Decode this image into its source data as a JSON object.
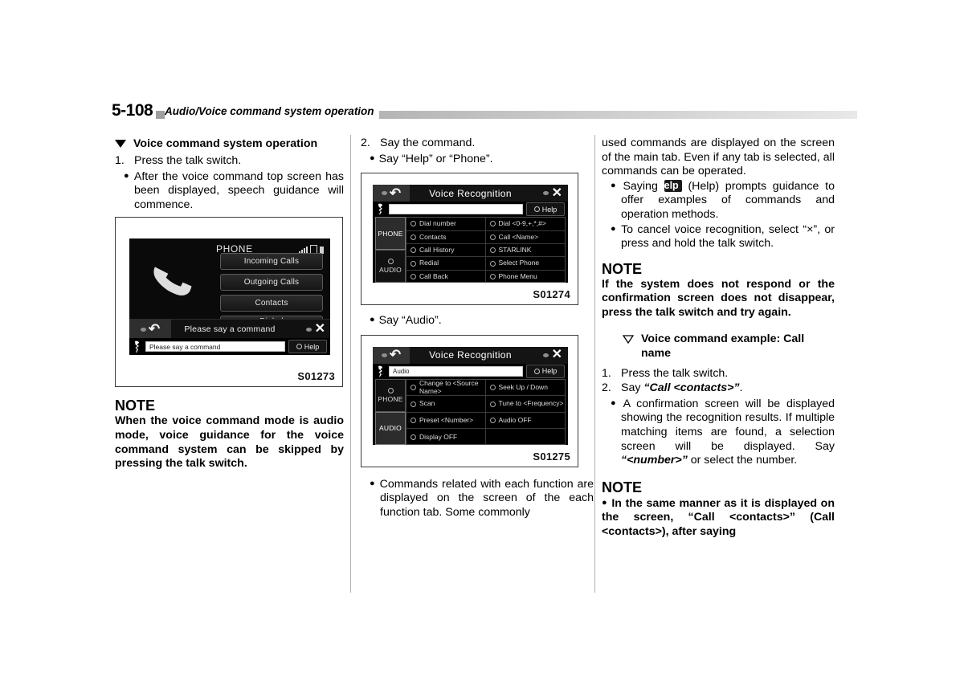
{
  "header": {
    "page_number": "5-108",
    "title": "Audio/Voice command system operation"
  },
  "column1": {
    "heading": "Voice command system operation",
    "step1_num": "1.",
    "step1_text": "Press the talk switch.",
    "step1_bullet": "After the voice command top screen has been displayed, speech guidance will commence.",
    "note_title": "NOTE",
    "note_body": "When the voice command mode is audio mode, voice guidance for the voice command system can be skipped by pressing the talk switch."
  },
  "column2": {
    "step2_num": "2.",
    "step2_text": "Say the command.",
    "step2_bullet": "Say “Help” or “Phone”.",
    "audio_bullet": "Say “Audio”.",
    "commands_bullet": "Commands related with each function are displayed on the screen of the each function tab. Some commonly"
  },
  "column3": {
    "continued_text": "used commands are displayed on the screen of the main tab. Even if any tab is selected, all commands can be operated.",
    "bullet_help_pre": "Saying",
    "bullet_help_box": "Help",
    "bullet_help_post": "(Help) prompts guidance to offer examples of commands and operation methods.",
    "bullet_cancel": "To cancel voice recognition, select “×”, or press and hold the talk switch.",
    "note1_title": "NOTE",
    "note1_body": "If the system does not respond or the confirmation screen does not disappear, press the talk switch and try again.",
    "subheading": "Voice command example: Call name",
    "ex_step1_num": "1.",
    "ex_step1_text": "Press the talk switch.",
    "ex_step2_num": "2.",
    "ex_step2_pre": "Say",
    "ex_step2_italic": "“Call <contacts>”",
    "ex_step2_post": ".",
    "ex_bullet_a": "A confirmation screen will be displayed showing the recognition results. If multiple matching items are found, a selection screen will be displayed. Say",
    "ex_bullet_a_italic": "“<number>”",
    "ex_bullet_a_post": "or select the number.",
    "note2_title": "NOTE",
    "note2_body": "In the same manner as it is displayed on the screen, “Call <contacts>” (Call <contacts>), after saying"
  },
  "figure1": {
    "caption": "S01273",
    "screen_title": "PHONE",
    "buttons": [
      "Incoming Calls",
      "Outgoing Calls",
      "Contacts",
      "Dialed"
    ],
    "status_bar_text": "Please say a command",
    "input_value": "Please say a command",
    "help_label": "Help"
  },
  "figure2": {
    "caption": "S01274",
    "screen_title": "Voice Recognition",
    "input_value": "",
    "help_label": "Help",
    "tabs": [
      {
        "label": "PHONE",
        "active": true
      },
      {
        "label": "AUDIO",
        "active": false
      }
    ],
    "commands_left": [
      "Dial number",
      "Contacts",
      "Call History",
      "Redial",
      "Call Back"
    ],
    "commands_right": [
      "Dial <0-9,+,*,#>",
      "Call <Name>",
      "STARLINK",
      "Select Phone",
      "Phone Menu"
    ]
  },
  "figure3": {
    "caption": "S01275",
    "screen_title": "Voice Recognition",
    "input_value": "Audio",
    "help_label": "Help",
    "tabs": [
      {
        "label": "PHONE",
        "active": false
      },
      {
        "label": "AUDIO",
        "active": true
      }
    ],
    "commands_left": [
      "Change to <Source Name>",
      "Scan",
      "Preset <Number>",
      "Display OFF"
    ],
    "commands_right": [
      "Seek Up / Down",
      "Tune to <Frequency>",
      "Audio OFF",
      ""
    ]
  },
  "colors": {
    "screen_bg": "#000000",
    "rule_gray": "#b0b0b0",
    "text": "#000000"
  }
}
